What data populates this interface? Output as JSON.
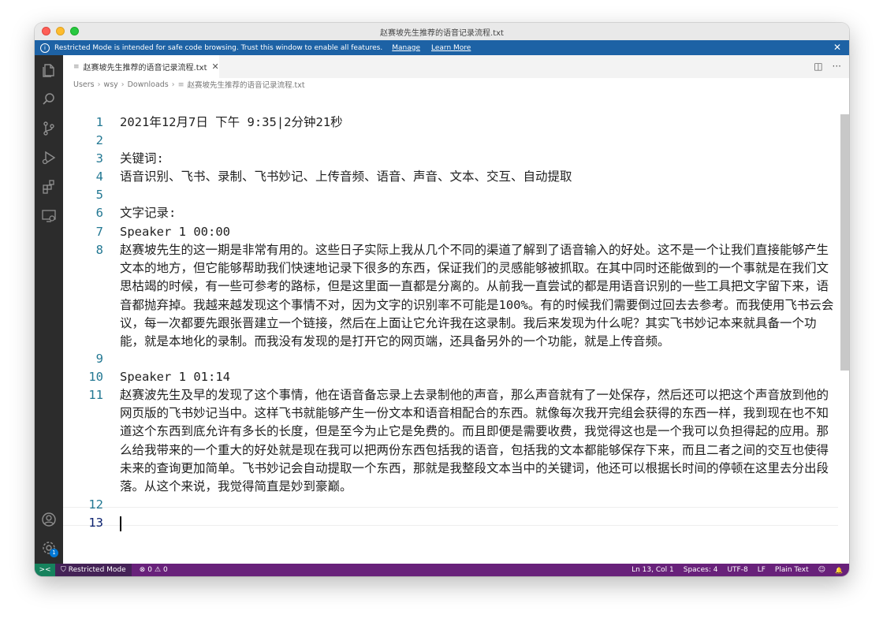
{
  "window": {
    "title": "赵赛坡先生推荐的语音记录流程.txt"
  },
  "banner": {
    "message": "Restricted Mode is intended for safe code browsing. Trust this window to enable all features.",
    "manage_label": "Manage",
    "learn_more_label": "Learn More",
    "close_glyph": "✕",
    "info_glyph": "i"
  },
  "tabs": [
    {
      "label": "赵赛坡先生推荐的语音记录流程.txt",
      "close_glyph": "✕",
      "file_glyph": "≡"
    }
  ],
  "tab_actions": {
    "split_glyph": "◫",
    "more_glyph": "···"
  },
  "breadcrumb": {
    "parts": [
      "Users",
      "wsy",
      "Downloads",
      "赵赛坡先生推荐的语音记录流程.txt"
    ],
    "separator": "›",
    "file_glyph": "≡"
  },
  "editor": {
    "lines": [
      {
        "num": "1",
        "text": "2021年12月7日 下午 9:35|2分钟21秒"
      },
      {
        "num": "2",
        "text": ""
      },
      {
        "num": "3",
        "text": "关键词:"
      },
      {
        "num": "4",
        "text": "语音识别、飞书、录制、飞书妙记、上传音频、语音、声音、文本、交互、自动提取"
      },
      {
        "num": "5",
        "text": ""
      },
      {
        "num": "6",
        "text": "文字记录:"
      },
      {
        "num": "7",
        "text": "Speaker 1 00:00"
      },
      {
        "num": "8",
        "text": "赵赛坡先生的这一期是非常有用的。这些日子实际上我从几个不同的渠道了解到了语音输入的好处。这不是一个让我们直接能够产生文本的地方，但它能够帮助我们快速地记录下很多的东西，保证我们的灵感能够被抓取。在其中同时还能做到的一个事就是在我们文思枯竭的时候，有一些可参考的路标，但是这里面一直都是分离的。从前我一直尝试的都是用语音识别的一些工具把文字留下来，语音都抛弃掉。我越来越发现这个事情不对，因为文字的识别率不可能是100%。有的时候我们需要倒过回去去参考。而我使用飞书云会议，每一次都要先跟张晋建立一个链接，然后在上面让它允许我在这录制。我后来发现为什么呢？其实飞书妙记本来就具备一个功能，就是本地化的录制。而我没有发现的是打开它的网页端，还具备另外的一个功能，就是上传音频。"
      },
      {
        "num": "9",
        "text": ""
      },
      {
        "num": "10",
        "text": "Speaker 1 01:14"
      },
      {
        "num": "11",
        "text": "赵赛波先生及早的发现了这个事情，他在语音备忘录上去录制他的声音，那么声音就有了一处保存，然后还可以把这个声音放到他的网页版的飞书妙记当中。这样飞书就能够产生一份文本和语音相配合的东西。就像每次我开完组会获得的东西一样，我到现在也不知道这个东西到底允许有多长的长度，但是至今为止它是免费的。而且即便是需要收费，我觉得这也是一个我可以负担得起的应用。那么给我带来的一个重大的好处就是现在我可以把两份东西包括我的语音，包括我的文本都能够保存下来，而且二者之间的交互也使得未来的查询更加简单。飞书妙记会自动提取一个东西，那就是我整段文本当中的关键词，他还可以根据长时间的停顿在这里去分出段落。从这个来说，我觉得简直是妙到豪巅。"
      },
      {
        "num": "12",
        "text": ""
      },
      {
        "num": "13",
        "text": ""
      }
    ]
  },
  "status": {
    "remote_glyph": "><",
    "restricted_label": "Restricted Mode",
    "restricted_glyph": "⛉",
    "errors": "0",
    "warnings": "0",
    "error_glyph": "⊗",
    "warning_glyph": "⚠",
    "position": "Ln 13, Col 1",
    "spaces": "Spaces: 4",
    "encoding": "UTF-8",
    "eol": "LF",
    "language": "Plain Text",
    "feedback_glyph": "☺",
    "bell_glyph": "🔔"
  },
  "activity": {
    "accounts_badge": "1"
  },
  "colors": {
    "banner": "#1d62a5",
    "statusbar": "#68217a",
    "activitybar": "#2c2c2c",
    "line_number": "#237893"
  }
}
